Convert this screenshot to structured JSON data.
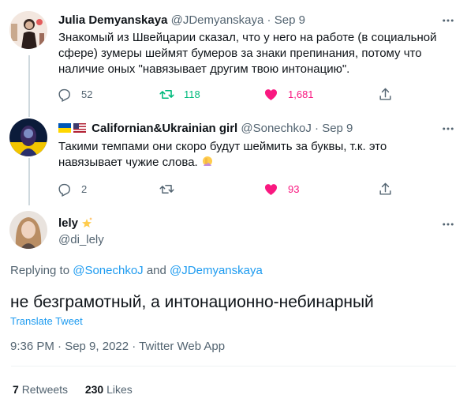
{
  "tweets": [
    {
      "name": "Julia Demyanskaya",
      "handle": "@JDemyanskaya",
      "sep": "·",
      "date": "Sep 9",
      "text": "Знакомый из Швейцарии сказал, что у него на работе (в социальной сфере) зумеры шеймят бумеров за знаки препинания, потому что наличие оных \"навязывает другим твою интонацию\".",
      "replies": "52",
      "retweets": "118",
      "likes": "1,681"
    },
    {
      "name": "Californian&Ukrainian girl",
      "handle": "@SonechkoJ",
      "sep": "·",
      "date": "Sep 9",
      "text": "Такими темпами они скоро будут шеймить за буквы, т.к. это навязывает чужие слова.",
      "replies": "2",
      "retweets": "",
      "likes": "93"
    }
  ],
  "main": {
    "name": "lely",
    "handle": "@di_lely",
    "replying_prefix": "Replying to ",
    "reply_to_1": "@SonechkoJ",
    "reply_and": " and ",
    "reply_to_2": "@JDemyanskaya",
    "text": "не безграмотный, а интонационно-небинарный",
    "translate": "Translate Tweet",
    "timestamp": "9:36 PM · Sep 9, 2022 · Twitter Web App",
    "retweets_count": "7",
    "retweets_label": "Retweets",
    "likes_count": "230",
    "likes_label": "Likes"
  },
  "icons": {
    "reply": "reply-icon",
    "retweet": "retweet-icon",
    "like": "heart-icon",
    "share": "share-icon",
    "more": "more-icon"
  },
  "colors": {
    "accent": "#1d9bf0",
    "retweet": "#00ba7c",
    "like": "#f91880",
    "muted": "#536471"
  }
}
